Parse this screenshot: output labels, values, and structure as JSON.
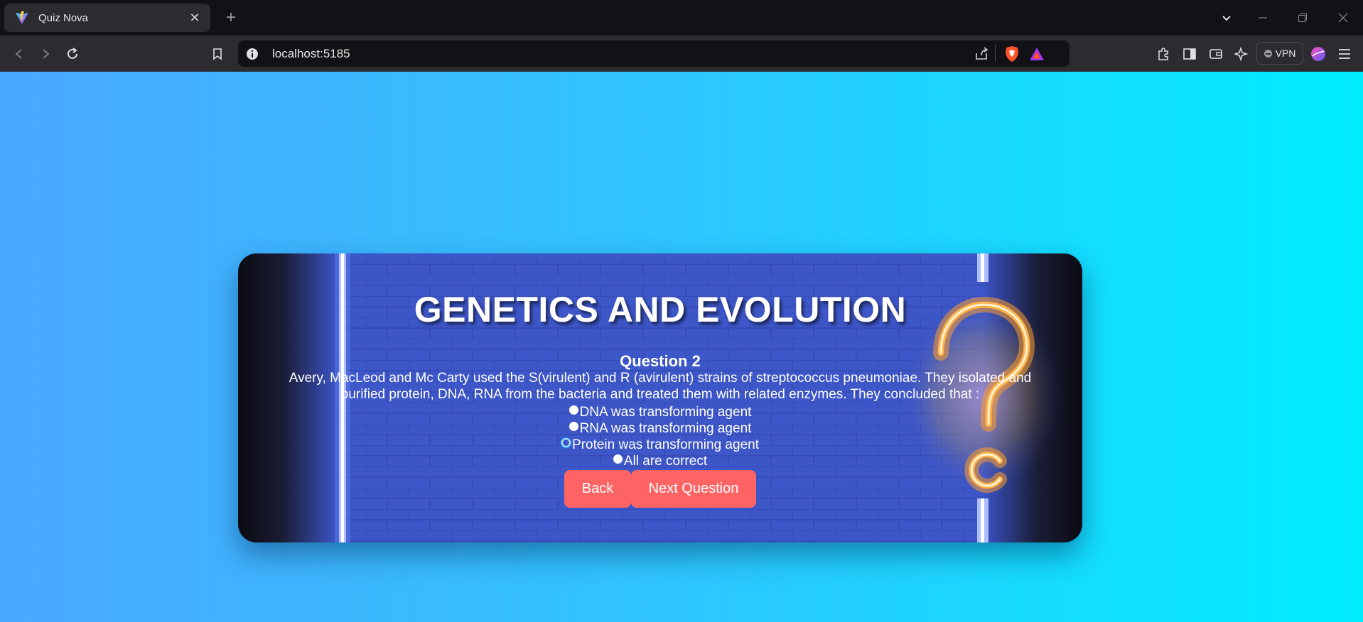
{
  "browser": {
    "tab_title": "Quiz Nova",
    "url": "localhost:5185",
    "vpn_label": "VPN"
  },
  "colors": {
    "accent_button": "#ff6464",
    "card_blue": "#3b55c9",
    "page_gradient_start": "#4aa8ff",
    "page_gradient_end": "#00eeff"
  },
  "quiz": {
    "title": "GENETICS AND EVOLUTION",
    "question_label": "Question 2",
    "question_text": "Avery, MacLeod and Mc Carty used the S(virulent) and R (avirulent) strains of streptococcus pneumoniae. They isolated and purified protein, DNA, RNA from the bacteria and treated them with related enzymes. They concluded that :",
    "options": [
      {
        "label": "DNA was transforming agent",
        "selected": false
      },
      {
        "label": "RNA was transforming agent",
        "selected": false
      },
      {
        "label": "Protein was transforming agent",
        "selected": true
      },
      {
        "label": "All are correct",
        "selected": false
      }
    ],
    "back_label": "Back",
    "next_label": "Next Question"
  }
}
